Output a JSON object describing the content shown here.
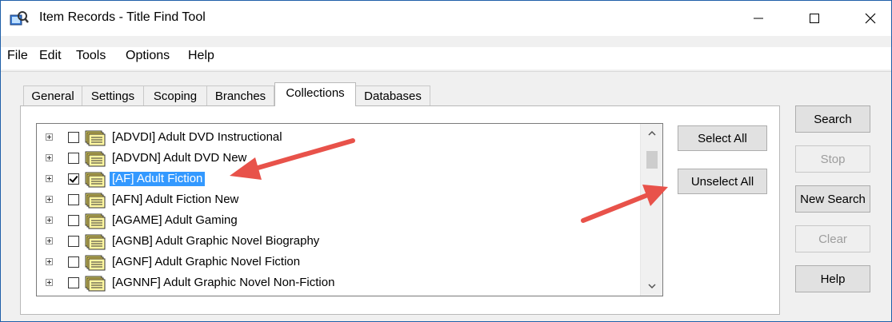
{
  "window": {
    "title": "Item Records - Title Find Tool"
  },
  "menu": [
    "File",
    "Edit",
    "Tools",
    "Options",
    "Help"
  ],
  "tabs": [
    "General",
    "Settings",
    "Scoping",
    "Branches",
    "Collections",
    "Databases"
  ],
  "active_tab": "Collections",
  "collections": [
    {
      "label": "[ADVDI] Adult DVD Instructional",
      "checked": false,
      "selected": false
    },
    {
      "label": "[ADVDN] Adult DVD New",
      "checked": false,
      "selected": false
    },
    {
      "label": "[AF] Adult Fiction",
      "checked": true,
      "selected": true
    },
    {
      "label": "[AFN] Adult Fiction New",
      "checked": false,
      "selected": false
    },
    {
      "label": "[AGAME] Adult Gaming",
      "checked": false,
      "selected": false
    },
    {
      "label": "[AGNB] Adult Graphic Novel Biography",
      "checked": false,
      "selected": false
    },
    {
      "label": "[AGNF] Adult Graphic Novel Fiction",
      "checked": false,
      "selected": false
    },
    {
      "label": "[AGNNF] Adult Graphic Novel Non-Fiction",
      "checked": false,
      "selected": false
    }
  ],
  "panel_buttons": {
    "select_all": "Select All",
    "unselect_all": "Unselect All"
  },
  "side_buttons": {
    "search": "Search",
    "stop": "Stop",
    "new_search": "New Search",
    "clear": "Clear",
    "help": "Help"
  },
  "colors": {
    "selection": "#3399ff",
    "annotation_arrow": "#e8524a"
  }
}
